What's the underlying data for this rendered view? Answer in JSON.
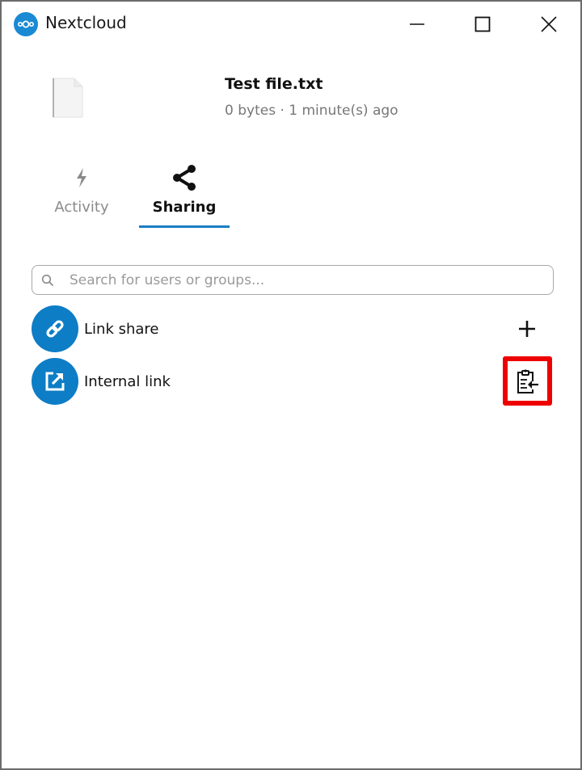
{
  "window": {
    "title": "Nextcloud",
    "controls": {
      "minimize": "minimize-icon",
      "maximize": "maximize-icon",
      "close": "close-icon"
    }
  },
  "file": {
    "name": "Test file.txt",
    "meta": "0 bytes · 1 minute(s) ago",
    "icon": "file-icon"
  },
  "tabs": [
    {
      "label": "Activity",
      "icon": "lightning-icon",
      "active": false
    },
    {
      "label": "Sharing",
      "icon": "share-icon",
      "active": true
    }
  ],
  "search": {
    "placeholder": "Search for users or groups...",
    "value": ""
  },
  "shares": [
    {
      "label": "Link share",
      "icon": "link-icon",
      "action": "add-icon"
    },
    {
      "label": "Internal link",
      "icon": "external-link-icon",
      "action": "copy-to-clipboard-icon",
      "highlighted": true
    }
  ],
  "colors": {
    "accent": "#0d7dc6",
    "tab_underline": "#1a7dc4",
    "highlight": "#ee0000"
  }
}
